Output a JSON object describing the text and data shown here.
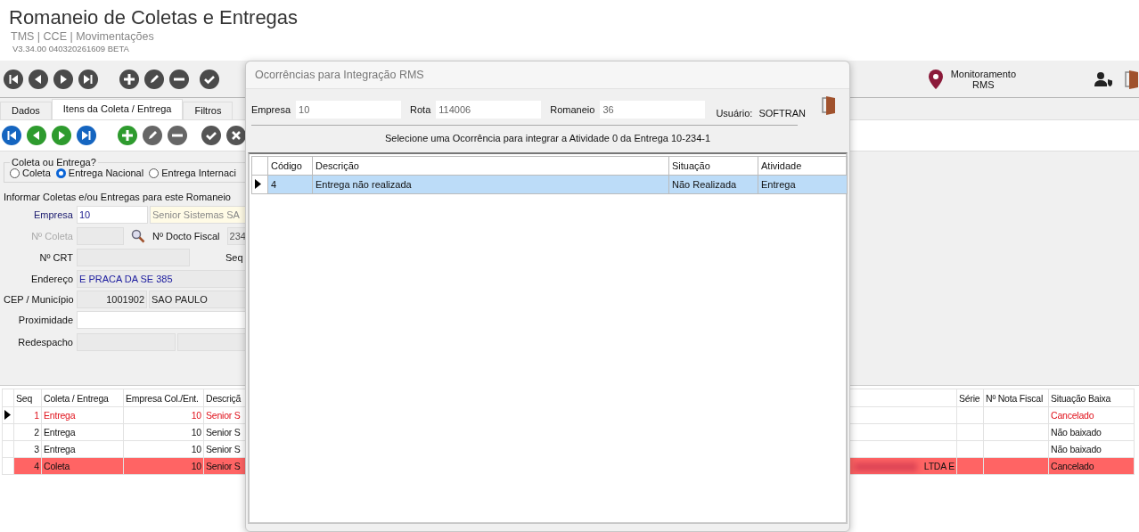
{
  "app": {
    "title": "Romaneio de Coletas e Entregas",
    "breadcrumb": "TMS | CCE | Movimentações",
    "version": "V3.34.00 040320261609 BETA"
  },
  "toolbar": {
    "monitor_label": "Monitoramento\nRMS"
  },
  "tabs": [
    {
      "label": "Dados",
      "selected": false
    },
    {
      "label": "Itens da Coleta / Entrega",
      "selected": true
    },
    {
      "label": "Filtros",
      "selected": false
    }
  ],
  "type_group": {
    "title": "Coleta ou Entrega?",
    "options": [
      {
        "label": "Coleta",
        "selected": false
      },
      {
        "label": "Entrega Nacional",
        "selected": true
      },
      {
        "label": "Entrega Internaci",
        "selected": false
      }
    ]
  },
  "form": {
    "title": "Informar Coletas e/ou Entregas para este Romaneio",
    "empresa": {
      "label": "Empresa",
      "value": "10",
      "description": "Senior Sistemas SA"
    },
    "coleta": {
      "label": "Nº Coleta",
      "disabled": true
    },
    "docto": {
      "label": "Nº Docto Fiscal",
      "value": "234"
    },
    "crt": {
      "label": "Nº CRT"
    },
    "seq": {
      "label": "Seq"
    },
    "endereco": {
      "label": "Endereço",
      "value": "E PRACA DA SE 385"
    },
    "cep": {
      "label": "CEP / Município",
      "value": "1001902",
      "municipio": "SAO PAULO"
    },
    "proximidade": {
      "label": "Proximidade"
    },
    "redespacho": {
      "label": "Redespacho"
    }
  },
  "grid": {
    "columns": [
      "Seq",
      "Coleta / Entrega",
      "Empresa Col./Ent.",
      "Descriçã",
      "",
      "Série",
      "Nº Nota Fiscal",
      "Situação Baixa"
    ],
    "rows": [
      {
        "current": true,
        "kind": "red_text",
        "cells": [
          "1",
          "Entrega",
          "10",
          "Senior S",
          "",
          "",
          "",
          "Cancelado"
        ]
      },
      {
        "current": false,
        "kind": "plain",
        "cells": [
          "2",
          "Entrega",
          "10",
          "Senior S",
          "",
          "",
          "",
          "Não baixado"
        ]
      },
      {
        "current": false,
        "kind": "plain",
        "cells": [
          "3",
          "Entrega",
          "10",
          "Senior S",
          "",
          "",
          "",
          "Não baixado"
        ]
      },
      {
        "current": false,
        "kind": "red_fill",
        "cells": [
          "4",
          "Coleta",
          "10",
          "Senior S",
          "LTDA E",
          "",
          "",
          "Cancelado"
        ]
      }
    ]
  },
  "dialog": {
    "title": "Ocorrências para Integração RMS",
    "fields": [
      {
        "label": "Empresa",
        "value": "10"
      },
      {
        "label": "Rota",
        "value": "114006"
      },
      {
        "label": "Romaneio",
        "value": "36"
      }
    ],
    "user_label": "Usuário:",
    "user": "SOFTRAN",
    "message": "Selecione uma Ocorrência para integrar a Atividade 0 da Entrega 10-234-1",
    "columns": [
      "Código",
      "Descrição",
      "Situação",
      "Atividade"
    ],
    "rows": [
      {
        "selected": true,
        "cells": [
          "4",
          "Entrega não realizada",
          "Não Realizada",
          "Entrega"
        ]
      }
    ]
  }
}
